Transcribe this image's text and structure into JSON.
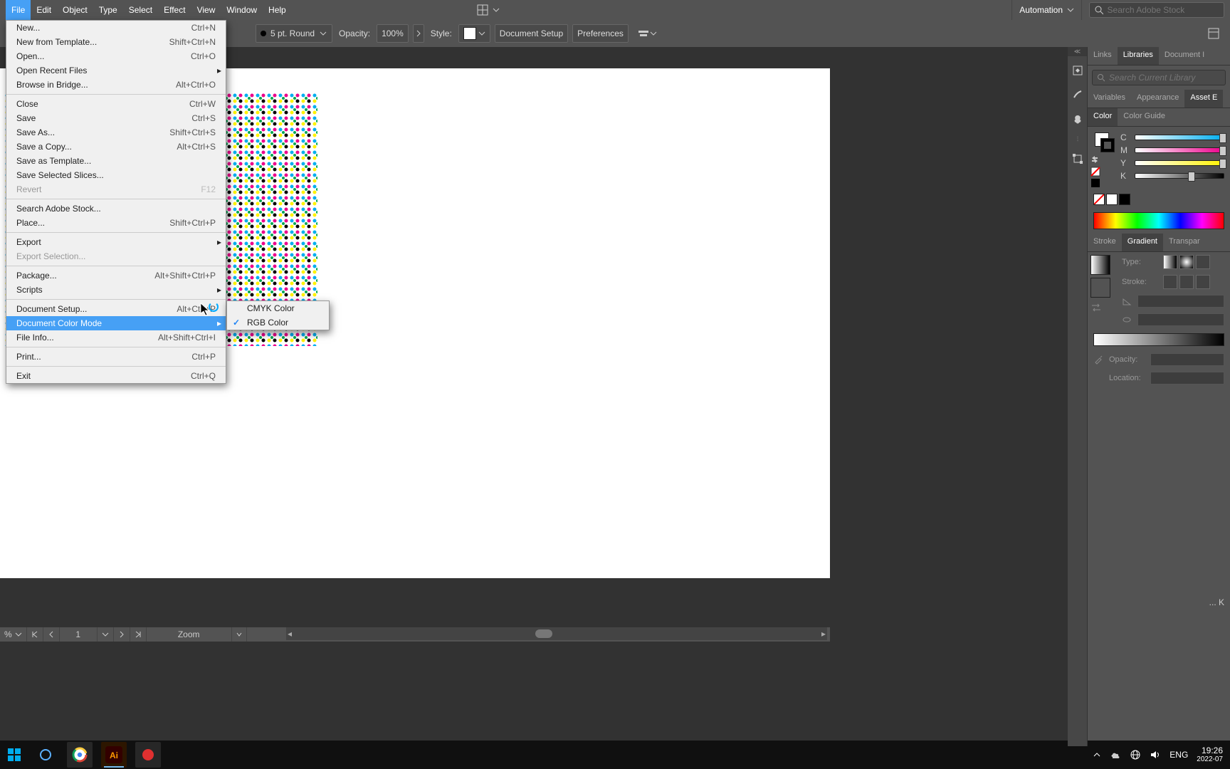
{
  "menubar": {
    "items": [
      "File",
      "Edit",
      "Object",
      "Type",
      "Select",
      "Effect",
      "View",
      "Window",
      "Help"
    ],
    "workspace_label": "Automation",
    "search_placeholder": "Search Adobe Stock"
  },
  "controlbar": {
    "stroke_label": "5 pt. Round",
    "opacity_label": "Opacity:",
    "opacity_value": "100%",
    "style_label": "Style:",
    "doc_setup": "Document Setup",
    "preferences": "Preferences"
  },
  "file_menu": {
    "items": [
      {
        "label": "New...",
        "kb": "Ctrl+N"
      },
      {
        "label": "New from Template...",
        "kb": "Shift+Ctrl+N"
      },
      {
        "label": "Open...",
        "kb": "Ctrl+O"
      },
      {
        "label": "Open Recent Files",
        "kb": "",
        "sub": true
      },
      {
        "label": "Browse in Bridge...",
        "kb": "Alt+Ctrl+O"
      },
      {
        "sep": true
      },
      {
        "label": "Close",
        "kb": "Ctrl+W"
      },
      {
        "label": "Save",
        "kb": "Ctrl+S"
      },
      {
        "label": "Save As...",
        "kb": "Shift+Ctrl+S"
      },
      {
        "label": "Save a Copy...",
        "kb": "Alt+Ctrl+S"
      },
      {
        "label": "Save as Template...",
        "kb": ""
      },
      {
        "label": "Save Selected Slices...",
        "kb": ""
      },
      {
        "label": "Revert",
        "kb": "F12",
        "disabled": true
      },
      {
        "sep": true
      },
      {
        "label": "Search Adobe Stock...",
        "kb": ""
      },
      {
        "label": "Place...",
        "kb": "Shift+Ctrl+P"
      },
      {
        "sep": true
      },
      {
        "label": "Export",
        "kb": "",
        "sub": true
      },
      {
        "label": "Export Selection...",
        "kb": "",
        "disabled": true
      },
      {
        "sep": true
      },
      {
        "label": "Package...",
        "kb": "Alt+Shift+Ctrl+P"
      },
      {
        "label": "Scripts",
        "kb": "",
        "sub": true
      },
      {
        "sep": true
      },
      {
        "label": "Document Setup...",
        "kb": "Alt+Ctrl+P"
      },
      {
        "label": "Document Color Mode",
        "kb": "",
        "sub": true,
        "highlight": true
      },
      {
        "label": "File Info...",
        "kb": "Alt+Shift+Ctrl+I"
      },
      {
        "sep": true
      },
      {
        "label": "Print...",
        "kb": "Ctrl+P"
      },
      {
        "sep": true
      },
      {
        "label": "Exit",
        "kb": "Ctrl+Q"
      }
    ]
  },
  "submenu": {
    "items": [
      {
        "label": "CMYK Color",
        "checked": false
      },
      {
        "label": "RGB Color",
        "checked": true
      }
    ]
  },
  "statusbar": {
    "zoom": "%",
    "artboard": "1",
    "tool": "Zoom"
  },
  "right_panels": {
    "tabs1": [
      "Links",
      "Libraries",
      "Document I"
    ],
    "active1": "Libraries",
    "lib_search_placeholder": "Search Current Library",
    "tabs2": [
      "Variables",
      "Appearance",
      "Asset E"
    ],
    "tabs3": [
      "Color",
      "Color Guide"
    ],
    "color_channels": [
      "C",
      "M",
      "Y",
      "K"
    ],
    "tabs4": [
      "Stroke",
      "Gradient",
      "Transpar"
    ],
    "gradient": {
      "type_label": "Type:",
      "stroke_label": "Stroke:",
      "angle_label": "",
      "opacity_label": "Opacity:",
      "location_label": "Location:"
    }
  },
  "taskbar": {
    "lang": "ENG",
    "time": "19:26",
    "date": "2022-07"
  },
  "cursor_hint": "... K"
}
